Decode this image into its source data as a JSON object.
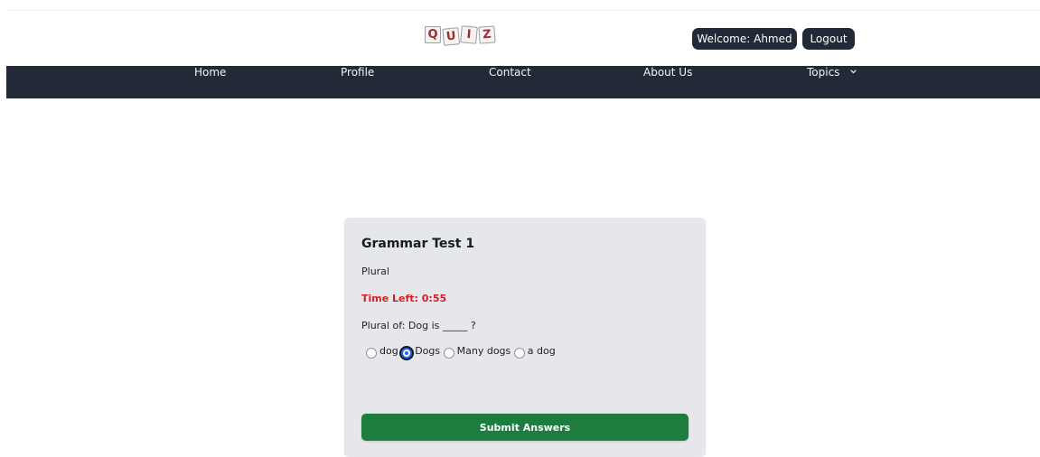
{
  "header": {
    "logo_letters": [
      "q",
      "u",
      "i",
      "z"
    ],
    "welcome_text": "Welcome: Ahmed",
    "logout_label": "Logout"
  },
  "nav": {
    "items": [
      "Home",
      "Profile",
      "Contact",
      "About Us",
      "Topics"
    ],
    "topics_icon": "chevron-down-icon"
  },
  "quiz": {
    "title": "Grammar Test 1",
    "subtitle": "Plural",
    "timer": "Time Left: 0:55",
    "question": "Plural of: Dog is _____ ?",
    "options": [
      "dog",
      "Dogs",
      "Many dogs",
      "a dog"
    ],
    "selected_option": "Dogs",
    "submit_label": "Submit Answers"
  },
  "colors": {
    "nav_bg": "#222a38",
    "card_bg": "#e6e7ea",
    "timer": "#d31f26",
    "submit": "#1d7d3f",
    "radio_selected": "#2563eb"
  }
}
